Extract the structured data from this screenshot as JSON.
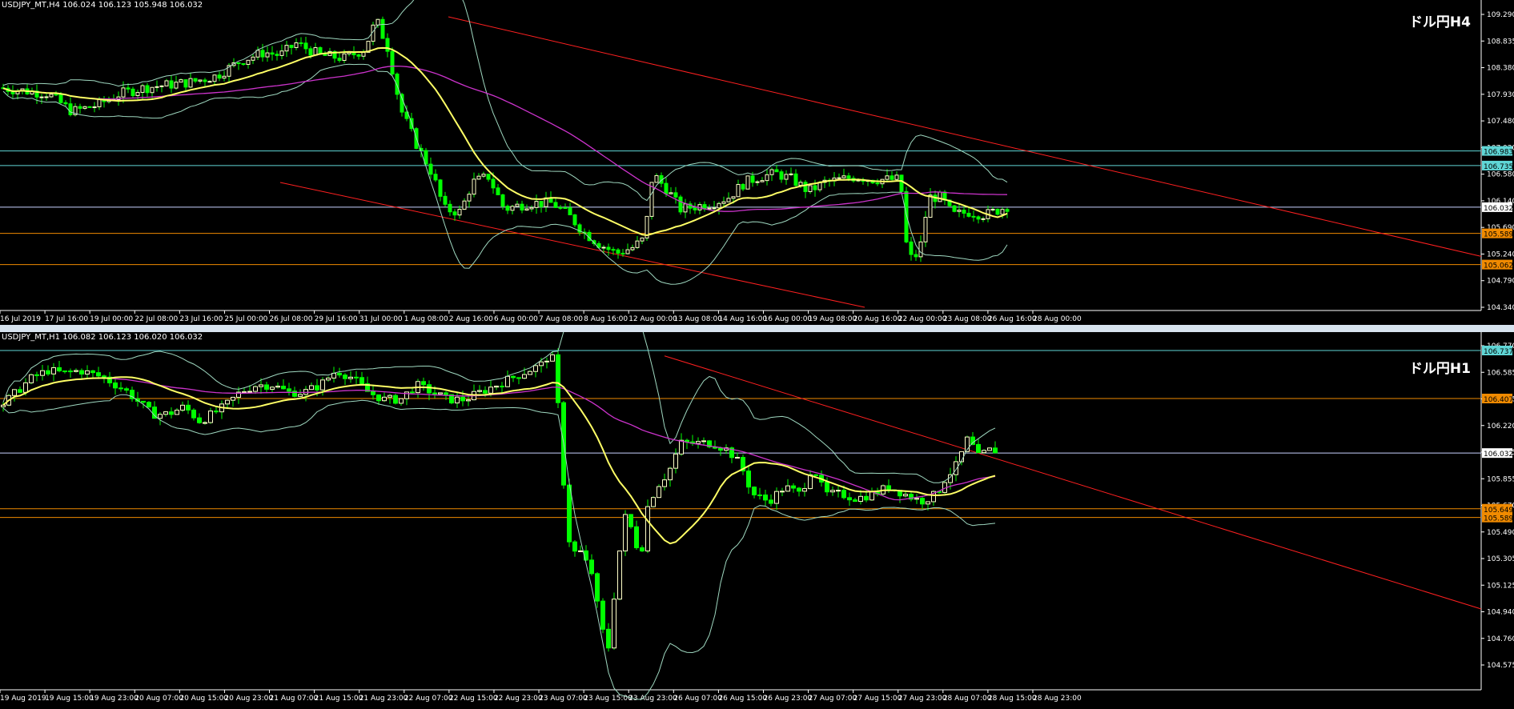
{
  "colors": {
    "background": "#000000",
    "grid": "#ffffff",
    "bull": "#ffffc8",
    "bear": "#00ff00",
    "ma_short": "#ffff66",
    "ma_long": "#cc33cc",
    "band": "#9fd8c0",
    "trendline": "#ff2020",
    "level_cyan": "#5fd6d6",
    "level_orange": "#f08a00",
    "current_price": "#c8d2ff"
  },
  "panels": {
    "h4": {
      "header": "USDJPY_MT,H4  106.024 106.123 105.948 106.032",
      "tag": "ドル円H4",
      "price_ticks": [
        "109.290",
        "108.835",
        "108.380",
        "107.930",
        "107.480",
        "107.030",
        "106.580",
        "106.140",
        "105.690",
        "105.240",
        "104.790",
        "104.340"
      ],
      "time_ticks": [
        "16 Jul 2019",
        "17 Jul 16:00",
        "19 Jul 00:00",
        "22 Jul 08:00",
        "23 Jul 16:00",
        "25 Jul 00:00",
        "26 Jul 08:00",
        "29 Jul 16:00",
        "31 Jul 00:00",
        "1 Aug 08:00",
        "2 Aug 16:00",
        "6 Aug 00:00",
        "7 Aug 08:00",
        "8 Aug 16:00",
        "12 Aug 00:00",
        "13 Aug 08:00",
        "14 Aug 16:00",
        "16 Aug 00:00",
        "19 Aug 08:00",
        "20 Aug 16:00",
        "22 Aug 00:00",
        "23 Aug 08:00",
        "26 Aug 16:00",
        "28 Aug 00:00"
      ],
      "level_labels": [
        {
          "text": "106.983",
          "kind": "cyan"
        },
        {
          "text": "106.735",
          "kind": "cyan"
        },
        {
          "text": "106.032",
          "kind": "current"
        },
        {
          "text": "105.589",
          "kind": "orange"
        },
        {
          "text": "105.062",
          "kind": "orange"
        }
      ]
    },
    "h1": {
      "header": "USDJPY_MT,H1  106.082 106.123 106.020 106.032",
      "tag": "ドル円H1",
      "price_ticks": [
        "106.770",
        "106.585",
        "106.405",
        "106.220",
        "106.035",
        "105.855",
        "105.670",
        "105.490",
        "105.305",
        "105.125",
        "104.940",
        "104.760",
        "104.575"
      ],
      "time_ticks": [
        "19 Aug 2019",
        "19 Aug 15:00",
        "19 Aug 23:00",
        "20 Aug 07:00",
        "20 Aug 15:00",
        "20 Aug 23:00",
        "21 Aug 07:00",
        "21 Aug 15:00",
        "21 Aug 23:00",
        "22 Aug 07:00",
        "22 Aug 15:00",
        "22 Aug 23:00",
        "23 Aug 07:00",
        "23 Aug 15:00",
        "23 Aug 23:00",
        "26 Aug 07:00",
        "26 Aug 15:00",
        "26 Aug 23:00",
        "27 Aug 07:00",
        "27 Aug 15:00",
        "27 Aug 23:00",
        "28 Aug 07:00",
        "28 Aug 15:00",
        "28 Aug 23:00"
      ],
      "level_labels": [
        {
          "text": "106.737",
          "kind": "cyan"
        },
        {
          "text": "106.407",
          "kind": "orange"
        },
        {
          "text": "106.032",
          "kind": "current"
        },
        {
          "text": "105.649",
          "kind": "orange"
        },
        {
          "text": "105.589",
          "kind": "orange"
        }
      ]
    }
  },
  "chart_data": [
    {
      "type": "candlestick",
      "title": "USDJPY_MT,H4",
      "ylim": [
        104.34,
        109.29
      ],
      "x_range": [
        "16 Jul 2019",
        "28 Aug 2019"
      ],
      "horizontal_levels": [
        106.983,
        106.735,
        106.032,
        105.589,
        105.062
      ],
      "series": [
        {
          "name": "USDJPY H4",
          "anchors": [
            [
              0,
              108.05
            ],
            [
              30,
              108.0
            ],
            [
              60,
              107.95
            ],
            [
              90,
              107.65
            ],
            [
              120,
              107.75
            ],
            [
              150,
              107.95
            ],
            [
              180,
              108.05
            ],
            [
              210,
              108.1
            ],
            [
              240,
              108.15
            ],
            [
              270,
              108.25
            ],
            [
              300,
              108.5
            ],
            [
              330,
              108.65
            ],
            [
              350,
              108.6
            ],
            [
              370,
              108.8
            ],
            [
              400,
              108.6
            ],
            [
              430,
              108.55
            ],
            [
              455,
              108.7
            ],
            [
              470,
              109.2
            ],
            [
              485,
              108.7
            ],
            [
              500,
              107.7
            ],
            [
              520,
              107.1
            ],
            [
              540,
              106.6
            ],
            [
              555,
              106.0
            ],
            [
              575,
              105.95
            ],
            [
              590,
              106.45
            ],
            [
              610,
              106.55
            ],
            [
              630,
              106.0
            ],
            [
              660,
              106.1
            ],
            [
              690,
              106.1
            ],
            [
              710,
              105.9
            ],
            [
              730,
              105.6
            ],
            [
              750,
              105.4
            ],
            [
              770,
              105.25
            ],
            [
              790,
              105.35
            ],
            [
              805,
              105.5
            ],
            [
              815,
              106.6
            ],
            [
              835,
              106.3
            ],
            [
              850,
              106.0
            ],
            [
              870,
              106.05
            ],
            [
              890,
              106.1
            ],
            [
              910,
              106.2
            ],
            [
              930,
              106.45
            ],
            [
              950,
              106.55
            ],
            [
              970,
              106.6
            ],
            [
              990,
              106.5
            ],
            [
              1010,
              106.3
            ],
            [
              1030,
              106.45
            ],
            [
              1050,
              106.5
            ],
            [
              1070,
              106.55
            ],
            [
              1090,
              106.5
            ],
            [
              1110,
              106.5
            ],
            [
              1125,
              106.5
            ],
            [
              1130,
              105.5
            ],
            [
              1140,
              105.1
            ],
            [
              1150,
              105.4
            ],
            [
              1160,
              106.2
            ],
            [
              1175,
              106.2
            ],
            [
              1190,
              105.9
            ],
            [
              1210,
              105.95
            ],
            [
              1230,
              105.9
            ],
            [
              1250,
              106.0
            ],
            [
              1258,
              106.05
            ]
          ]
        }
      ]
    },
    {
      "type": "candlestick",
      "title": "USDJPY_MT,H1",
      "ylim": [
        104.575,
        106.77
      ],
      "x_range": [
        "19 Aug 2019",
        "28 Aug 23:00"
      ],
      "horizontal_levels": [
        106.737,
        106.407,
        106.032,
        105.649,
        105.589
      ],
      "series": [
        {
          "name": "USDJPY H1",
          "anchors": [
            [
              0,
              106.35
            ],
            [
              20,
              106.45
            ],
            [
              40,
              106.55
            ],
            [
              60,
              106.6
            ],
            [
              80,
              106.58
            ],
            [
              100,
              106.6
            ],
            [
              130,
              106.55
            ],
            [
              160,
              106.45
            ],
            [
              190,
              106.3
            ],
            [
              210,
              106.3
            ],
            [
              230,
              106.35
            ],
            [
              250,
              106.25
            ],
            [
              280,
              106.35
            ],
            [
              300,
              106.45
            ],
            [
              320,
              106.5
            ],
            [
              340,
              106.5
            ],
            [
              360,
              106.45
            ],
            [
              380,
              106.45
            ],
            [
              400,
              106.5
            ],
            [
              420,
              106.6
            ],
            [
              440,
              106.55
            ],
            [
              460,
              106.45
            ],
            [
              480,
              106.4
            ],
            [
              500,
              106.4
            ],
            [
              520,
              106.5
            ],
            [
              540,
              106.45
            ],
            [
              560,
              106.4
            ],
            [
              580,
              106.4
            ],
            [
              600,
              106.45
            ],
            [
              620,
              106.5
            ],
            [
              640,
              106.55
            ],
            [
              660,
              106.6
            ],
            [
              680,
              106.65
            ],
            [
              688,
              106.75
            ],
            [
              695,
              106.5
            ],
            [
              702,
              106.0
            ],
            [
              708,
              105.5
            ],
            [
              715,
              105.35
            ],
            [
              725,
              105.35
            ],
            [
              740,
              105.2
            ],
            [
              750,
              104.85
            ],
            [
              760,
              104.7
            ],
            [
              770,
              105.2
            ],
            [
              780,
              105.6
            ],
            [
              790,
              105.5
            ],
            [
              800,
              105.3
            ],
            [
              808,
              105.65
            ],
            [
              820,
              105.8
            ],
            [
              835,
              105.9
            ],
            [
              850,
              106.1
            ],
            [
              870,
              106.1
            ],
            [
              890,
              106.1
            ],
            [
              910,
              106.05
            ],
            [
              925,
              105.95
            ],
            [
              940,
              105.75
            ],
            [
              960,
              105.7
            ],
            [
              980,
              105.8
            ],
            [
              1000,
              105.75
            ],
            [
              1015,
              105.95
            ],
            [
              1030,
              105.75
            ],
            [
              1050,
              105.75
            ],
            [
              1070,
              105.72
            ],
            [
              1090,
              105.75
            ],
            [
              1110,
              105.8
            ],
            [
              1130,
              105.75
            ],
            [
              1150,
              105.7
            ],
            [
              1170,
              105.75
            ],
            [
              1180,
              105.85
            ],
            [
              1195,
              105.95
            ],
            [
              1210,
              106.15
            ],
            [
              1220,
              106.0
            ],
            [
              1235,
              106.05
            ],
            [
              1245,
              106.05
            ]
          ]
        }
      ]
    }
  ]
}
